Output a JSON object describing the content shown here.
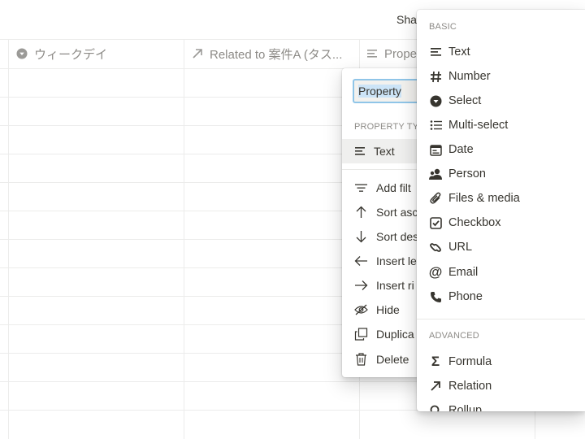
{
  "topbar": {
    "share_label": "Sha"
  },
  "table": {
    "columns": [
      {
        "label": "ウィークデイ",
        "icon": "select-icon"
      },
      {
        "label": "Related to 案件A (タス...",
        "icon": "relation-arrow-icon"
      },
      {
        "label": "Prope",
        "icon": "text-lines-icon"
      }
    ]
  },
  "property_menu": {
    "name_value": "Property",
    "type_section_label": "PROPERTY TYP",
    "current_type": {
      "label": "Text",
      "icon": "text-lines-icon"
    },
    "actions": [
      {
        "label": "Add filt",
        "icon": "filter-icon"
      },
      {
        "label": "Sort asc",
        "icon": "arrow-up-icon"
      },
      {
        "label": "Sort des",
        "icon": "arrow-down-icon"
      },
      {
        "label": "Insert le",
        "icon": "arrow-left-icon"
      },
      {
        "label": "Insert ri",
        "icon": "arrow-right-icon"
      },
      {
        "label": "Hide",
        "icon": "eye-slash-icon"
      },
      {
        "label": "Duplica",
        "icon": "duplicate-icon"
      },
      {
        "label": "Delete",
        "icon": "trash-icon"
      }
    ]
  },
  "type_menu": {
    "basic_label": "BASIC",
    "basic_items": [
      {
        "label": "Text",
        "icon": "text-lines-icon"
      },
      {
        "label": "Number",
        "icon": "hash-icon"
      },
      {
        "label": "Select",
        "icon": "select-icon"
      },
      {
        "label": "Multi-select",
        "icon": "list-icon"
      },
      {
        "label": "Date",
        "icon": "calendar-icon"
      },
      {
        "label": "Person",
        "icon": "person-icon"
      },
      {
        "label": "Files & media",
        "icon": "paperclip-icon"
      },
      {
        "label": "Checkbox",
        "icon": "checkbox-icon"
      },
      {
        "label": "URL",
        "icon": "link-icon"
      },
      {
        "label": "Email",
        "icon": "at-icon"
      },
      {
        "label": "Phone",
        "icon": "phone-icon"
      }
    ],
    "advanced_label": "ADVANCED",
    "advanced_items": [
      {
        "label": "Formula",
        "icon": "sigma-icon"
      },
      {
        "label": "Relation",
        "icon": "relation-arrow-icon"
      },
      {
        "label": "Rollup",
        "icon": "search-icon"
      }
    ]
  }
}
